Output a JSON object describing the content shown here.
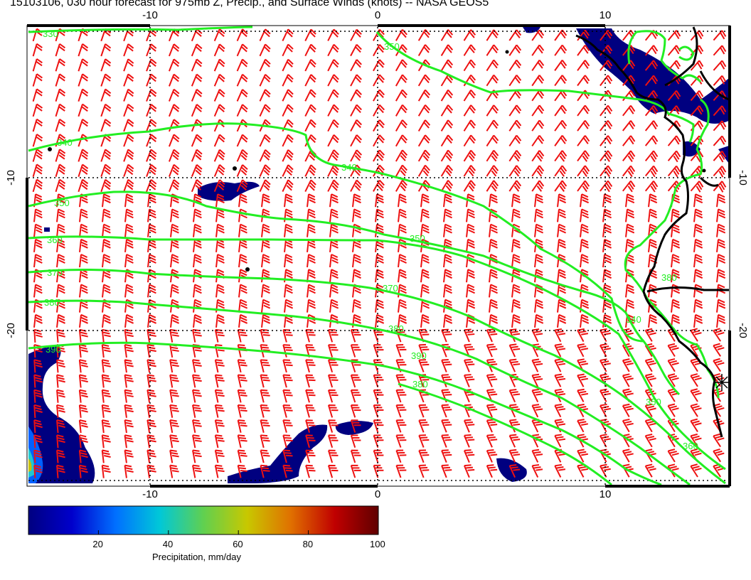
{
  "title": "15103106, 030 hour forecast for 975mb Z, Precip., and Surface Winds (knots) -- NASA GEOS5",
  "map": {
    "lon_labels": [
      "-10",
      "0",
      "10"
    ],
    "lat_labels": [
      "-10",
      "-20"
    ],
    "lon_range": [
      -15.5,
      15.5
    ],
    "lat_range": [
      -28.5,
      1.5
    ],
    "gridlines": "dotted",
    "contour_color": "#22ee22",
    "wind_barb_color": "#ee1111",
    "coastline_color": "#000000",
    "contour_labels": [
      "330",
      "340",
      "340",
      "350",
      "360",
      "370",
      "380",
      "390",
      "350",
      "370",
      "380",
      "390",
      "340",
      "350",
      "380",
      "350",
      "360",
      "380"
    ]
  },
  "colorbar": {
    "ticks": [
      "20",
      "40",
      "60",
      "80",
      "100"
    ],
    "range": [
      0,
      100
    ],
    "title": "Precipitation, mm/day",
    "colors": [
      "#000080",
      "#0000cc",
      "#0070ff",
      "#00c8d8",
      "#60d050",
      "#c8c800",
      "#e07000",
      "#c00000",
      "#600000"
    ]
  }
}
